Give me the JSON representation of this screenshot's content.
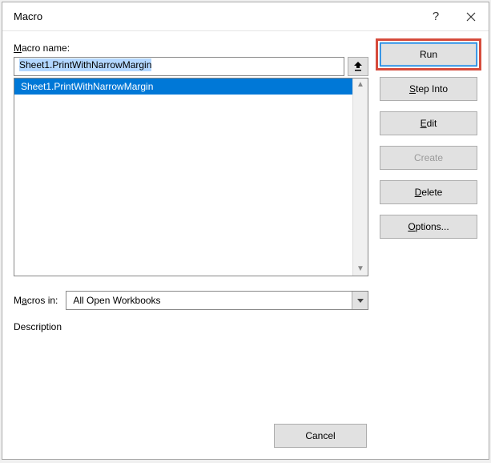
{
  "title": "Macro",
  "labels": {
    "macro_name": "Macro name:",
    "macros_in": "Macros in:",
    "description": "Description"
  },
  "input": {
    "value": "Sheet1.PrintWithNarrowMargin"
  },
  "list": {
    "items": [
      "Sheet1.PrintWithNarrowMargin"
    ]
  },
  "dropdown": {
    "selected": "All Open Workbooks"
  },
  "buttons": {
    "run": "Run",
    "step_into": "Step Into",
    "edit": "Edit",
    "create": "Create",
    "delete": "Delete",
    "options": "Options...",
    "cancel": "Cancel"
  }
}
